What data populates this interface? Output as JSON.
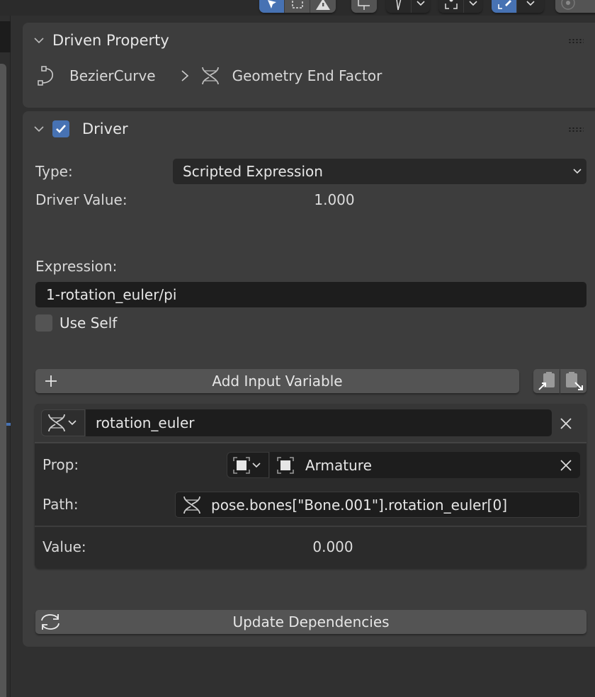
{
  "toolbar": {
    "groups": [
      {
        "name": "select-mode-group",
        "buttons": [
          "tweak-select-icon",
          "box-select-icon",
          "warning-icon"
        ]
      },
      {
        "name": "view-transform-group",
        "buttons": [
          "transform-icon"
        ]
      },
      {
        "name": "pivot-group",
        "buttons": [
          "pivot-icon",
          "chevron-down-icon"
        ]
      },
      {
        "name": "snap-target-group",
        "buttons": [
          "snap-target-icon",
          "chevron-down-icon"
        ]
      },
      {
        "name": "snap-group",
        "buttons": [
          "snap-icon",
          "chevron-down-icon"
        ]
      },
      {
        "name": "proportional-edit-group",
        "buttons": [
          "proportional-edit-icon"
        ]
      }
    ],
    "accent_color": "#4772b3"
  },
  "driven_property": {
    "title": "Driven Property",
    "object_name": "BezierCurve",
    "property_name": "Geometry End Factor"
  },
  "driver": {
    "title": "Driver",
    "enabled": true,
    "type_label": "Type:",
    "type_value": "Scripted Expression",
    "driver_value_label": "Driver Value:",
    "driver_value": "1.000",
    "expression_label": "Expression:",
    "expression": "1-rotation_euler/pi",
    "use_self_label": "Use Self",
    "use_self": false,
    "add_variable_label": "Add Input Variable",
    "copy_vars_icon": "copy-to-clipboard-icon",
    "paste_vars_icon": "paste-from-clipboard-icon",
    "variable": {
      "name": "rotation_euler",
      "type_icon": "rna-icon",
      "prop_label": "Prop:",
      "id_type_icon": "object-icon",
      "id_name": "Armature",
      "path_label": "Path:",
      "path": "pose.bones[\"Bone.001\"].rotation_euler[0]",
      "value_label": "Value:",
      "value": "0.000"
    },
    "update_label": "Update Dependencies"
  }
}
